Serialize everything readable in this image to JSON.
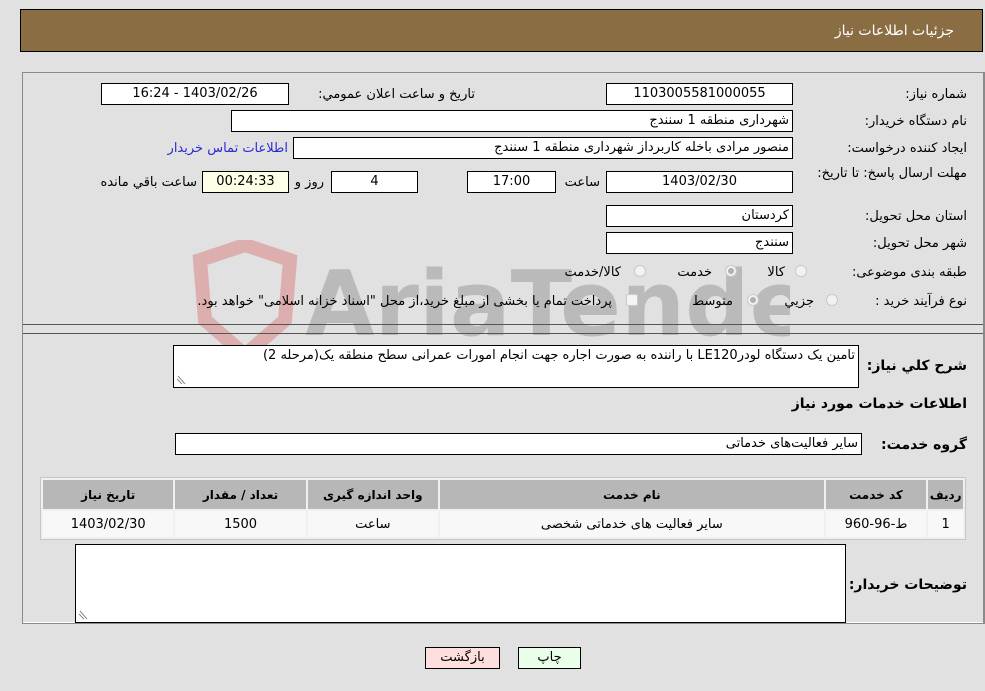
{
  "header": {
    "title": "جزئيات اطلاعات نیاز"
  },
  "fields": {
    "need_number": {
      "label": "شماره نیاز:",
      "value": "1103005581000055"
    },
    "announce_datetime": {
      "label": "تاریخ و ساعت اعلان عمومي:",
      "value": "1403/02/26 - 16:24"
    },
    "buyer_org": {
      "label": "نام دستگاه خریدار:",
      "value": "شهرداری منطقه 1 سنندج"
    },
    "creator": {
      "label": "ایجاد کننده درخواست:",
      "value": "منصور مرادی باخله کاربرداز شهرداری منطقه 1 سنندج"
    },
    "buyer_contact_link": "اطلاعات تماس خریدار",
    "deadline": {
      "label": "مهلت ارسال پاسخ: تا تاریخ:",
      "date": "1403/02/30",
      "time_label": "ساعت",
      "time": "17:00",
      "days": "4",
      "days_label": "روز و",
      "remaining": "00:24:33",
      "remaining_label": "ساعت باقي مانده"
    },
    "province": {
      "label": "استان محل تحویل:",
      "value": "کردستان"
    },
    "city": {
      "label": "شهر محل تحویل:",
      "value": "سنندج"
    },
    "category": {
      "label": "طبقه بندی موضوعی:",
      "options": [
        "کالا",
        "خدمت",
        "کالا/خدمت"
      ],
      "selected": "خدمت"
    },
    "purchase_type": {
      "label": "نوع فرآیند خرید :",
      "options": [
        "جزيي",
        "متوسط"
      ],
      "selected": "متوسط",
      "treasury_note": "پرداخت تمام یا بخشی از مبلغ خرید،از محل \"اسناد خزانه اسلامی\" خواهد بود."
    }
  },
  "description": {
    "label": "شرح کلي نياز:",
    "value": "تامین یک دستگاه لودرLE120 با راننده به صورت اجاره جهت انجام امورات عمرانی سطح منطقه یک(مرحله 2)"
  },
  "services_section": {
    "title": "اطلاعات خدمات مورد نیاز",
    "group_label": "گروه خدمت:",
    "group_value": "سایر فعالیت‌های خدماتی",
    "table": {
      "headers": [
        "ردیف",
        "کد خدمت",
        "نام خدمت",
        "واحد اندازه گیری",
        "تعداد / مقدار",
        "تاریخ نیاز"
      ],
      "rows": [
        [
          "1",
          "ط-96-960",
          "سایر فعالیت های خدماتی شخصی",
          "ساعت",
          "1500",
          "1403/02/30"
        ]
      ]
    }
  },
  "buyer_notes": {
    "label": "توضیحات خریدار:",
    "value": ""
  },
  "buttons": {
    "print": "چاپ",
    "back": "بازگشت"
  },
  "watermark": "AriaTender.neT",
  "colors": {
    "header_bg": "#8b6d43",
    "print_bg": "#e9ffe9",
    "back_bg": "#ffdede",
    "remaining_bg": "#ffffe7",
    "link": "#2b2bd6"
  }
}
